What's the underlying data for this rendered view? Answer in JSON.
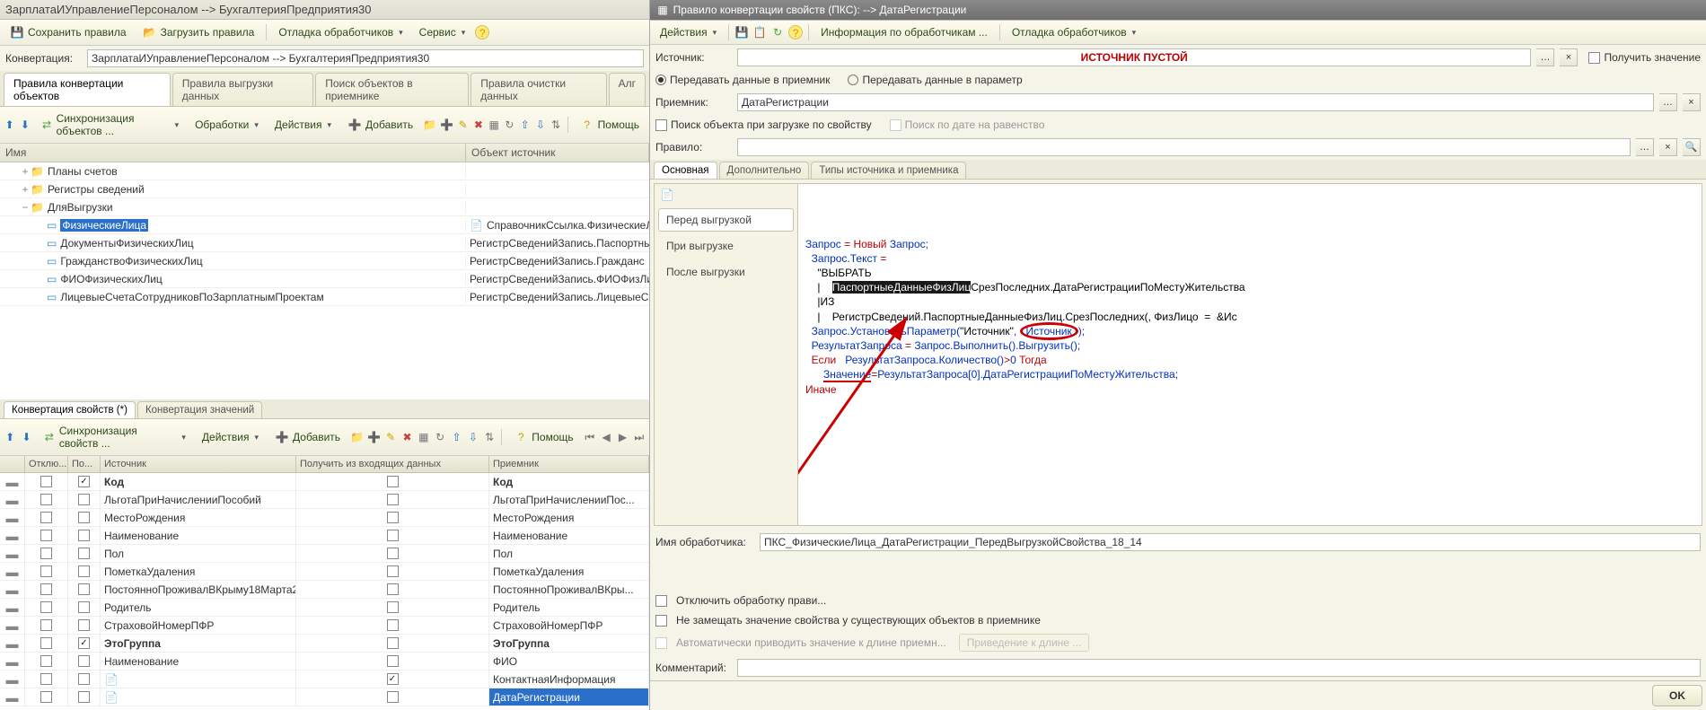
{
  "left": {
    "title": "ЗарплатаИУправлениеПерсоналом --> БухгалтерияПредприятия30",
    "toolbar": {
      "save": "Сохранить правила",
      "load": "Загрузить правила",
      "debug": "Отладка обработчиков",
      "service": "Сервис"
    },
    "conv_label": "Конвертация:",
    "conv_value": "ЗарплатаИУправлениеПерсоналом --> БухгалтерияПредприятия30",
    "tabs": [
      "Правила конвертации объектов",
      "Правила выгрузки данных",
      "Поиск объектов в приемнике",
      "Правила очистки данных",
      "Алг"
    ],
    "tree_toolbar": {
      "sync": "Синхронизация объектов ...",
      "proc": "Обработки",
      "actions": "Действия",
      "add": "Добавить",
      "help": "Помощь"
    },
    "tree_headers": {
      "name": "Имя",
      "src": "Объект источник"
    },
    "tree": [
      {
        "indent": 1,
        "toggle": "+",
        "icon": "folder",
        "name": "Планы счетов",
        "src": ""
      },
      {
        "indent": 1,
        "toggle": "+",
        "icon": "folder",
        "name": "Регистры сведений",
        "src": ""
      },
      {
        "indent": 1,
        "toggle": "−",
        "icon": "folder",
        "name": "ДляВыгрузки",
        "src": ""
      },
      {
        "indent": 2,
        "toggle": "",
        "icon": "doc",
        "name": "ФизическиеЛица",
        "src_icon": true,
        "src": "СправочникСсылка.ФизическиеЛи",
        "selected": true
      },
      {
        "indent": 2,
        "toggle": "",
        "icon": "doc",
        "name": "ДокументыФизическихЛиц",
        "src": "РегистрСведенийЗапись.Паспортнь"
      },
      {
        "indent": 2,
        "toggle": "",
        "icon": "doc",
        "name": "ГражданствоФизическихЛиц",
        "src": "РегистрСведенийЗапись.Гражданс"
      },
      {
        "indent": 2,
        "toggle": "",
        "icon": "doc",
        "name": "ФИОФизическихЛиц",
        "src": "РегистрСведенийЗапись.ФИОФизЛи"
      },
      {
        "indent": 2,
        "toggle": "",
        "icon": "doc",
        "name": "ЛицевыеСчетаСотрудниковПоЗарплатнымПроектам",
        "src": "РегистрСведенийЗапись.ЛицевыеСч"
      }
    ],
    "sub_tabs": [
      "Конвертация свойств (*)",
      "Конвертация значений"
    ],
    "grid_toolbar": {
      "sync": "Синхронизация свойств ...",
      "actions": "Действия",
      "add": "Добавить",
      "help": "Помощь"
    },
    "grid_headers": [
      "",
      "Отклю...",
      "По...",
      "Источник",
      "Получить из входящих данных",
      "Приемник"
    ],
    "grid_rows": [
      {
        "po": true,
        "source": "Код",
        "get_in": false,
        "receiver": "Код",
        "bold": true
      },
      {
        "po": false,
        "source": "ЛьготаПриНачисленииПособий",
        "get_in": false,
        "receiver": "ЛьготаПриНачисленииПос..."
      },
      {
        "po": false,
        "source": "МестоРождения",
        "get_in": false,
        "receiver": "МестоРождения"
      },
      {
        "po": false,
        "source": "Наименование",
        "get_in": false,
        "receiver": "Наименование"
      },
      {
        "po": false,
        "source": "Пол",
        "get_in": false,
        "receiver": "Пол"
      },
      {
        "po": false,
        "source": "ПометкаУдаления",
        "get_in": false,
        "receiver": "ПометкаУдаления"
      },
      {
        "po": false,
        "source": "ПостоянноПроживалВКрыму18Марта2...",
        "get_in": false,
        "receiver": "ПостоянноПроживалВКры..."
      },
      {
        "po": false,
        "source": "Родитель",
        "get_in": false,
        "receiver": "Родитель"
      },
      {
        "po": false,
        "source": "СтраховойНомерПФР",
        "get_in": false,
        "receiver": "СтраховойНомерПФР"
      },
      {
        "po": true,
        "source": "ЭтоГруппа",
        "get_in": false,
        "receiver": "ЭтоГруппа",
        "bold": true
      },
      {
        "po": false,
        "source": "Наименование",
        "get_in": false,
        "receiver": "ФИО"
      },
      {
        "po": false,
        "source": "",
        "src_icon": true,
        "get_in": true,
        "receiver": "КонтактнаяИнформация"
      },
      {
        "po": false,
        "source": "",
        "src_icon": true,
        "get_in": false,
        "receiver": "ДатаРегистрации",
        "highlight": true
      }
    ]
  },
  "right": {
    "title": "Правило конвертации свойств (ПКС): --> ДатаРегистрации",
    "toolbar": {
      "actions": "Действия",
      "info": "Информация по обработчикам ...",
      "debug": "Отладка обработчиков"
    },
    "src_label": "Источник:",
    "src_value": "ИСТОЧНИК ПУСТОЙ",
    "get_value_chk": "Получить значение",
    "radio1": "Передавать данные в приемник",
    "radio2": "Передавать данные в параметр",
    "rcv_label": "Приемник:",
    "rcv_value": "ДатаРегистрации",
    "search_chk": "Поиск объекта при загрузке по свойству",
    "date_chk": "Поиск по дате на равенство",
    "rule_label": "Правило:",
    "tabs": [
      "Основная",
      "Дополнительно",
      "Типы источника и приемника"
    ],
    "events": [
      "Перед выгрузкой",
      "При выгрузке",
      "После выгрузки"
    ],
    "code_lines": [
      [
        {
          "t": "Запрос ",
          "c": "blue"
        },
        {
          "t": "= ",
          "c": "red"
        },
        {
          "t": "Новый ",
          "c": "red"
        },
        {
          "t": "Запрос;",
          "c": "blue"
        }
      ],
      [
        {
          "t": "  Запрос.Текст ",
          "c": "blue"
        },
        {
          "t": "=",
          "c": "red"
        }
      ],
      [
        {
          "t": "    \"ВЫБРАТЬ",
          "c": "black"
        }
      ],
      [
        {
          "t": "    |    ",
          "c": "black"
        },
        {
          "t": "ПаспортныеДанныеФизЛиц",
          "c": "inv"
        },
        {
          "t": "СрезПоследних.ДатаРегистрацииПоМестуЖительства",
          "c": "black"
        }
      ],
      [
        {
          "t": "    |ИЗ",
          "c": "black"
        }
      ],
      [
        {
          "t": "    |    РегистрСведений.ПаспортныеДанныеФизЛиц.СрезПоследних(, ФизЛицо  =  &Ис",
          "c": "black"
        }
      ],
      [
        {
          "t": "",
          "c": "black"
        }
      ],
      [
        {
          "t": "  Запрос.УстановитьПараметр(",
          "c": "blue"
        },
        {
          "t": "\"Источник\"",
          "c": "black"
        },
        {
          "t": ", ",
          "c": "blue"
        },
        {
          "t": "Источник",
          "c": "circled"
        },
        {
          "t": ");",
          "c": "blue"
        }
      ],
      [
        {
          "t": "",
          "c": "black"
        }
      ],
      [
        {
          "t": "  РезультатЗапроса ",
          "c": "blue"
        },
        {
          "t": "= ",
          "c": "red"
        },
        {
          "t": "Запрос.Выполнить().Выгрузить();",
          "c": "blue"
        }
      ],
      [
        {
          "t": "  Если   ",
          "c": "red"
        },
        {
          "t": "РезультатЗапроса.Количество()",
          "c": "blue"
        },
        {
          "t": ">",
          "c": "red"
        },
        {
          "t": "0 ",
          "c": "blue"
        },
        {
          "t": "Тогда",
          "c": "red"
        }
      ],
      [
        {
          "t": "      ",
          "c": "black"
        },
        {
          "t": "Значение",
          "c": "sq-blue"
        },
        {
          "t": "=",
          "c": "red"
        },
        {
          "t": "РезультатЗапроса[",
          "c": "blue"
        },
        {
          "t": "0",
          "c": "blue"
        },
        {
          "t": "].ДатаРегистрацииПоМестуЖительства;",
          "c": "blue"
        }
      ],
      [
        {
          "t": "Иначе",
          "c": "red"
        }
      ]
    ],
    "handler_label": "Имя обработчика:",
    "handler_value": "ПКС_ФизическиеЛица_ДатаРегистрации_ПередВыгрузкойСвойства_18_14",
    "opt1": "Отключить обработку прави...",
    "opt2": "Не замещать значение свойства у существующих объектов в приемнике",
    "opt3": "Автоматически приводить значение к длине приемн...",
    "opt3_btn": "Приведение к длине ...",
    "comment_label": "Комментарий:",
    "ok_btn": "OK"
  }
}
